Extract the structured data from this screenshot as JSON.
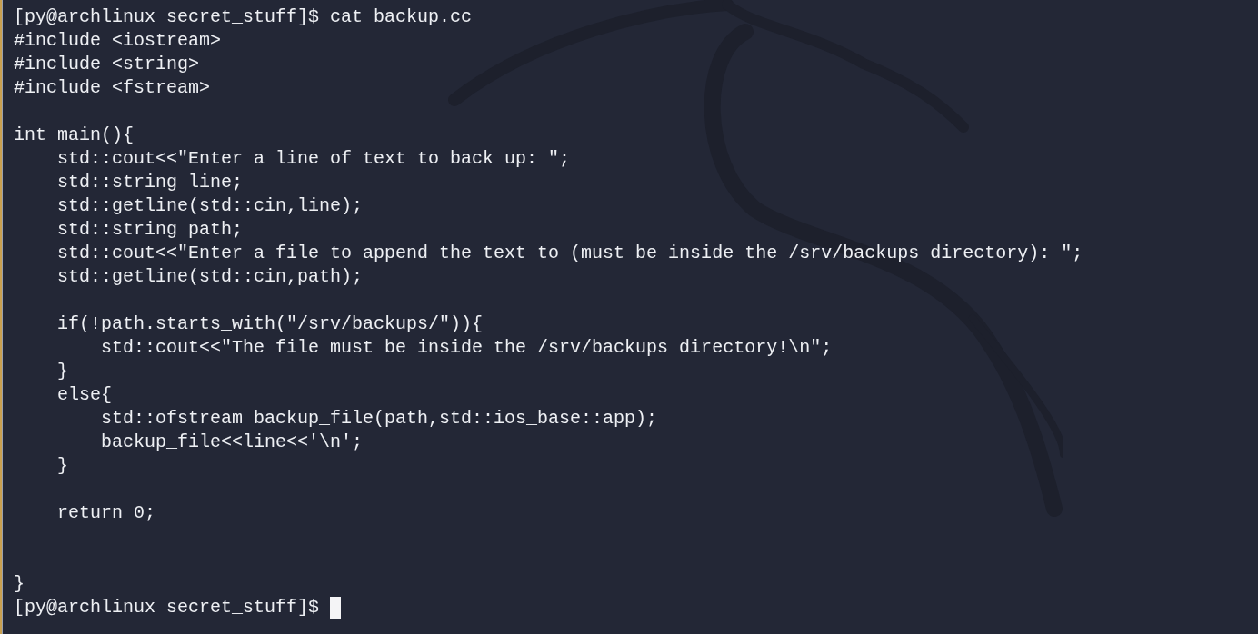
{
  "terminal": {
    "lines": [
      {
        "kind": "prompt",
        "prompt": "[py@archlinux secret_stuff]$",
        "command": "cat backup.cc",
        "cursor": false
      },
      {
        "kind": "code",
        "text": "#include <iostream>"
      },
      {
        "kind": "code",
        "text": "#include <string>"
      },
      {
        "kind": "code",
        "text": "#include <fstream>"
      },
      {
        "kind": "blank"
      },
      {
        "kind": "code",
        "text": "int main(){"
      },
      {
        "kind": "code",
        "text": "    std::cout<<\"Enter a line of text to back up: \";"
      },
      {
        "kind": "code",
        "text": "    std::string line;"
      },
      {
        "kind": "code",
        "text": "    std::getline(std::cin,line);"
      },
      {
        "kind": "code",
        "text": "    std::string path;"
      },
      {
        "kind": "code",
        "text": "    std::cout<<\"Enter a file to append the text to (must be inside the /srv/backups directory): \";"
      },
      {
        "kind": "code",
        "text": "    std::getline(std::cin,path);"
      },
      {
        "kind": "blank"
      },
      {
        "kind": "code",
        "text": "    if(!path.starts_with(\"/srv/backups/\")){"
      },
      {
        "kind": "code",
        "text": "        std::cout<<\"The file must be inside the /srv/backups directory!\\n\";"
      },
      {
        "kind": "code",
        "text": "    }"
      },
      {
        "kind": "code",
        "text": "    else{"
      },
      {
        "kind": "code",
        "text": "        std::ofstream backup_file(path,std::ios_base::app);"
      },
      {
        "kind": "code",
        "text": "        backup_file<<line<<'\\n';"
      },
      {
        "kind": "code",
        "text": "    }"
      },
      {
        "kind": "blank"
      },
      {
        "kind": "code",
        "text": "    return 0;"
      },
      {
        "kind": "blank"
      },
      {
        "kind": "blank"
      },
      {
        "kind": "code",
        "text": "}"
      },
      {
        "kind": "prompt",
        "prompt": "[py@archlinux secret_stuff]$",
        "cursor": true
      }
    ]
  }
}
